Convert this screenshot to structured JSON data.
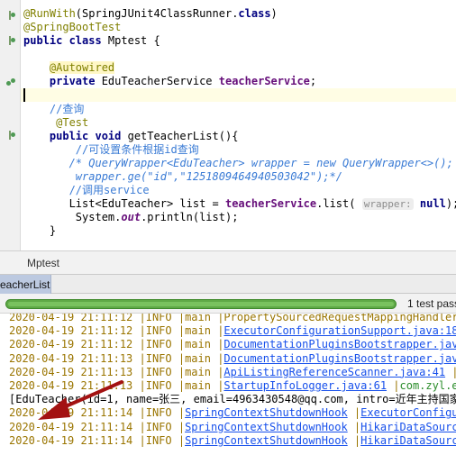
{
  "editor": {
    "lines": [
      {
        "parts": [
          [
            "ann",
            "@RunWith"
          ],
          [
            "",
            "(SpringJUnit4ClassRunner."
          ],
          [
            "kw",
            "class"
          ],
          [
            "",
            ")"
          ]
        ]
      },
      {
        "parts": [
          [
            "ann",
            "@SpringBootTest"
          ]
        ]
      },
      {
        "parts": [
          [
            "kw",
            "public class "
          ],
          [
            "",
            "Mptest {"
          ]
        ]
      },
      {
        "parts": [
          [
            "",
            ""
          ]
        ]
      },
      {
        "parts": [
          [
            "",
            "    "
          ],
          [
            "annhl",
            "@Autowired"
          ]
        ]
      },
      {
        "parts": [
          [
            "",
            "    "
          ],
          [
            "kw",
            "private "
          ],
          [
            "",
            "EduTeacherService "
          ],
          [
            "fld",
            "teacherService"
          ],
          [
            "",
            ";"
          ]
        ]
      },
      {
        "parts": [
          [
            "",
            ""
          ]
        ]
      },
      {
        "parts": [
          [
            "",
            ""
          ]
        ]
      },
      {
        "parts": [
          [
            "",
            "    "
          ],
          [
            "cmts",
            "//查询"
          ]
        ]
      },
      {
        "parts": [
          [
            "",
            "     "
          ],
          [
            "ann",
            "@Test"
          ]
        ]
      },
      {
        "parts": [
          [
            "",
            "    "
          ],
          [
            "kw",
            "public void "
          ],
          [
            "",
            "getTeacherList(){"
          ]
        ]
      },
      {
        "parts": [
          [
            "",
            "        "
          ],
          [
            "cmts",
            "//可设置条件根据id查询"
          ]
        ]
      },
      {
        "parts": [
          [
            "",
            "       "
          ],
          [
            "cmtb",
            "/* QueryWrapper<EduTeacher> wrapper = new QueryWrapper<>();"
          ]
        ]
      },
      {
        "parts": [
          [
            "",
            "        "
          ],
          [
            "cmtb",
            "wrapper.ge(\"id\",\"1251809464940503042\");*/"
          ]
        ]
      },
      {
        "parts": [
          [
            "",
            "       "
          ],
          [
            "cmts",
            "//调用service"
          ]
        ]
      },
      {
        "parts": [
          [
            "",
            "       List<EduTeacher> list = "
          ],
          [
            "fld",
            "teacherService"
          ],
          [
            "",
            ".list( "
          ],
          [
            "hint",
            "wrapper:"
          ],
          [
            "",
            " "
          ],
          [
            "kw",
            "null"
          ],
          [
            "",
            ");"
          ]
        ]
      },
      {
        "parts": [
          [
            "",
            "        System."
          ],
          [
            "ital",
            "out"
          ],
          [
            "",
            ".println(list);"
          ]
        ]
      },
      {
        "parts": [
          [
            "",
            "    }"
          ]
        ]
      }
    ]
  },
  "run_window": {
    "title": "Mptest",
    "tab_label": "eacherList",
    "status": "1 test pass",
    "progress_fraction": 1.0
  },
  "console": {
    "lines": [
      {
        "parts": [
          [
            "",
            "2020-04-19 21:11:12 |INFO |main |PropertySourcedRequestMappingHandlerM"
          ]
        ]
      },
      {
        "parts": [
          [
            "",
            "2020-04-19 21:11:12 |INFO |main |"
          ],
          [
            "cls",
            "ExecutorConfigurationSupport.java:181"
          ]
        ]
      },
      {
        "parts": [
          [
            "",
            "2020-04-19 21:11:12 |INFO |main |"
          ],
          [
            "cls",
            "DocumentationPluginsBootstrapper.java"
          ]
        ]
      },
      {
        "parts": [
          [
            "",
            "2020-04-19 21:11:13 |INFO |main |"
          ],
          [
            "cls",
            "DocumentationPluginsBootstrapper.java"
          ]
        ]
      },
      {
        "parts": [
          [
            "",
            "2020-04-19 21:11:13 |INFO |main |"
          ],
          [
            "cls",
            "ApiListingReferenceScanner.java:41"
          ],
          [
            "",
            " |"
          ],
          [
            "pkg",
            "s"
          ]
        ]
      },
      {
        "parts": [
          [
            "",
            "2020-04-19 21:11:13 |INFO |main |"
          ],
          [
            "cls",
            "StartupInfoLogger.java:61"
          ],
          [
            "",
            " |"
          ],
          [
            "pkg",
            "com.zyl.ed"
          ]
        ]
      },
      {
        "parts": [
          [
            "out",
            "[EduTeacher(id=1, name=张三, email=4963430548@qq.com, intro=近年主持国家自"
          ]
        ]
      },
      {
        "parts": [
          [
            "",
            "2020-04-19 21:11:14 |INFO |"
          ],
          [
            "cls",
            "SpringContextShutdownHook"
          ],
          [
            "",
            " |"
          ],
          [
            "cls",
            "ExecutorConfigur"
          ]
        ]
      },
      {
        "parts": [
          [
            "",
            "2020-04-19 21:11:14 |INFO |"
          ],
          [
            "cls",
            "SpringContextShutdownHook"
          ],
          [
            "",
            " |"
          ],
          [
            "cls",
            "HikariDataSource"
          ]
        ]
      },
      {
        "parts": [
          [
            "",
            "2020-04-19 21:11:14 |INFO |"
          ],
          [
            "cls",
            "SpringContextShutdownHook"
          ],
          [
            "",
            " |"
          ],
          [
            "cls",
            "HikariDataSource"
          ]
        ]
      }
    ]
  },
  "colors": {
    "log_text": "#9a7500",
    "link": "#1750eb",
    "pass_green": "#5fa946",
    "arrow": "#a31212"
  },
  "icons": [
    "run-test-class-icon",
    "bean-icon",
    "run-test-method-icon",
    "arrow-annotation"
  ]
}
